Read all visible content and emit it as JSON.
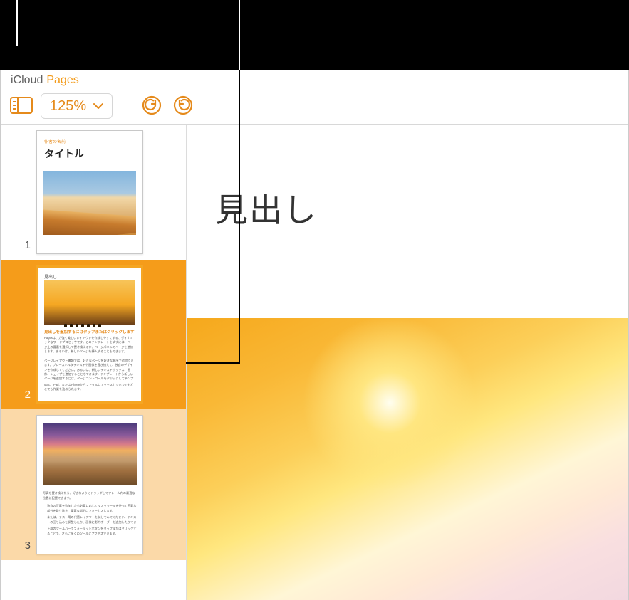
{
  "brand": {
    "icloud": "iCloud",
    "pages": "Pages"
  },
  "toolbar": {
    "view_icon": "sidebar-view-icon",
    "zoom_value": "125%",
    "undo_icon": "undo-icon",
    "redo_icon": "redo-icon"
  },
  "editor": {
    "heading": "見出し"
  },
  "thumbnails": [
    {
      "number": "1",
      "selected": false,
      "section_tint": false,
      "kind": "title-page",
      "category_label": "作者の名前",
      "title": "タイトル"
    },
    {
      "number": "2",
      "selected": true,
      "section_tint": false,
      "kind": "heading-text-page",
      "mini_heading": "見出し",
      "sub_heading": "見出しを追加するにはタップまたはクリックします",
      "body_preview_1": "Pagesは、力強く美しいレイアウトを作成しやすくする、ダイナミックなワードプロセッサです。このテンプレートを試すには、ページ上の要素を選択して置き換えるか、ページパネルでページを追加します。あるいは、新しいページを挿入することもできます。",
      "body_preview_2": "ページレイアウト書類では、好きなページを好きな順序で追加できます。プレースホルダテキストや画像を置き換えて、独自のデザインを作成してください。あるいは、新しいテキストボックス、画像、シェイプを追加することもできます。テンプレートから新しいページを追加するには、ページコントロールをクリックしてテンプレートを選択します。",
      "body_preview_3": "Mac、iPad、またはiPhoneからファイルにアクセスしていつでもどこでも作業を進められます。"
    },
    {
      "number": "3",
      "selected": false,
      "section_tint": true,
      "kind": "image-bullets-page",
      "body_preview_1": "写真を置き換えたら、好きなようにドラッグしてフレーム内の最適な位置に配置できます。",
      "bullet_1": "独自の写真を追加したら必要に応じてマスクツールを使って不要な部分を取り除き、重要な部分にフォーカスします。",
      "bullet_2": "または、テスト用の代替レイアウトを試してみてください。テキストの回り込みを調整したり、画像に影やボーダーを追加したりできます。",
      "bullet_3": "上部のツールバーでフォーマットボタンをタップまたはクリックすることで、さらに多くのツールにアクセスできます。"
    }
  ]
}
